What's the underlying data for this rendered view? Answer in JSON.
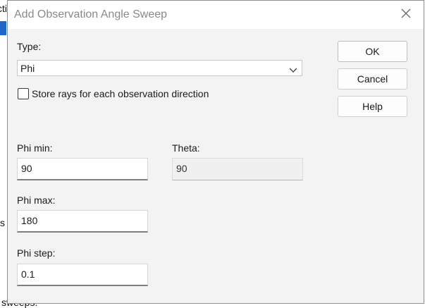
{
  "background": {
    "text_top": "cti",
    "text_mid": "s",
    "text_bottom": "sweeps:"
  },
  "dialog": {
    "title": "Add Observation Angle Sweep",
    "type_label": "Type:",
    "type_value": "Phi",
    "store_rays_label": "Store rays for each observation direction",
    "store_rays_checked": false,
    "buttons": {
      "ok": "OK",
      "cancel": "Cancel",
      "help": "Help"
    },
    "phi_min_label": "Phi min:",
    "phi_min_value": "90",
    "theta_label": "Theta:",
    "theta_value": "90",
    "phi_max_label": "Phi max:",
    "phi_max_value": "180",
    "phi_step_label": "Phi step:",
    "phi_step_value": "0.1"
  },
  "icons": {
    "close": "close-icon",
    "dropdown": "chevron-down-icon"
  }
}
